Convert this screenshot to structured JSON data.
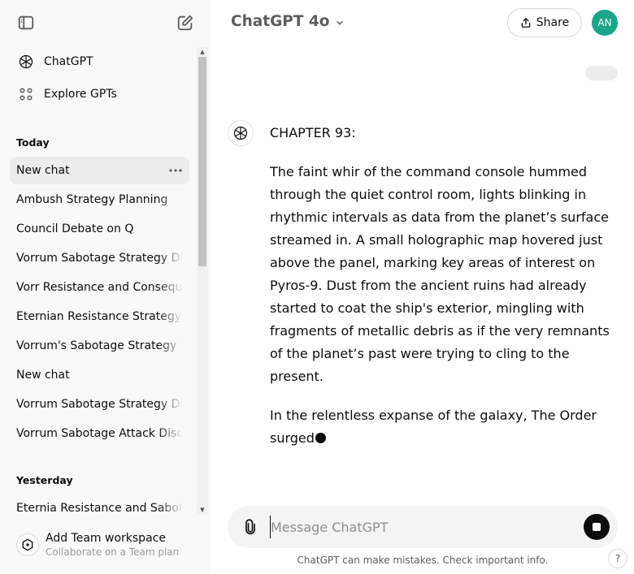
{
  "sidebar": {
    "nav": [
      {
        "label": "ChatGPT",
        "icon": "openai-logo-icon"
      },
      {
        "label": "Explore GPTs",
        "icon": "grid-icon"
      }
    ],
    "sections": [
      {
        "label": "Today",
        "items": [
          {
            "title": "New chat",
            "active": true
          },
          {
            "title": "Ambush Strategy Planning"
          },
          {
            "title": "Council Debate on Q"
          },
          {
            "title": "Vorrum Sabotage Strategy Discussion"
          },
          {
            "title": "Vorr Resistance and Consequences"
          },
          {
            "title": "Eternian Resistance Strategy"
          },
          {
            "title": "Vorrum's Sabotage Strategy"
          },
          {
            "title": "New chat"
          },
          {
            "title": "Vorrum Sabotage Strategy Discussion"
          },
          {
            "title": "Vorrum Sabotage Attack Discussion"
          }
        ]
      },
      {
        "label": "Yesterday",
        "items": [
          {
            "title": "Eternia Resistance and Sabotage"
          }
        ]
      }
    ],
    "team": {
      "title": "Add Team workspace",
      "subtitle": "Collaborate on a Team plan"
    }
  },
  "header": {
    "model": "ChatGPT 4o",
    "share_label": "Share",
    "avatar_initials": "AN"
  },
  "conversation": {
    "assistant_paragraphs": [
      "CHAPTER 93:",
      "The faint whir of the command console hummed through the quiet control room, lights blinking in rhythmic intervals as data from the planet’s surface streamed in. A small holographic map hovered just above the panel, marking key areas of interest on Pyros-9. Dust from the ancient ruins had already started to coat the ship's exterior, mingling with fragments of metallic debris as if the very remnants of the planet’s past were trying to cling to the present.",
      "In the relentless expanse of the galaxy, The Order surged"
    ]
  },
  "composer": {
    "placeholder": "Message ChatGPT",
    "value": ""
  },
  "footer": {
    "disclaimer": "ChatGPT can make mistakes. Check important info.",
    "help_label": "?"
  },
  "colors": {
    "sidebar_bg": "#f9f9f9",
    "active_item_bg": "#ececec",
    "avatar_bg": "#19a589",
    "composer_bg": "#f4f4f4"
  }
}
